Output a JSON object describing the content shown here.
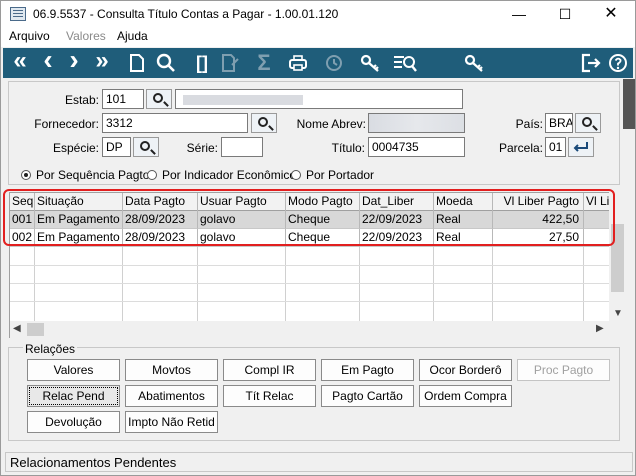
{
  "window": {
    "title": "06.9.5537 - Consulta Título Contas a Pagar - 1.00.01.120",
    "controls": {
      "minimize": "—",
      "maximize": "☐",
      "close": "✕"
    }
  },
  "menu": {
    "items": [
      "Arquivo",
      "Valores",
      "Ajuda"
    ]
  },
  "toolbar": {
    "first_glyph": "«",
    "prev_glyph": "‹",
    "next_glyph": "›",
    "last_glyph": "»",
    "brackets_glyph": "[]",
    "sigma_glyph": "Σ"
  },
  "filters": {
    "estab_label": "Estab:",
    "estab_value": "101",
    "fornecedor_label": "Fornecedor:",
    "fornecedor_value": "3312",
    "especie_label": "Espécie:",
    "especie_value": "DP",
    "serie_label": "Série:",
    "serie_value": "",
    "nome_abrev_label": "Nome Abrev:",
    "titulo_label": "Título:",
    "titulo_value": "0004735",
    "pais_label": "País:",
    "pais_value": "BRA",
    "parcela_label": "Parcela:",
    "parcela_value": "01"
  },
  "sort_options": {
    "opt1": "Por Sequência Pagto",
    "opt2": "Por Indicador Econômico",
    "opt3": "Por Portador",
    "selected": "Por Sequência Pagto"
  },
  "table": {
    "headers": [
      "Seq",
      "Situação",
      "Data Pagto",
      "Usuar Pagto",
      "Modo Pagto",
      "Dat_Liber",
      "Moeda",
      "Vl Liber Pagto",
      "Vl Li"
    ],
    "rows": [
      [
        "001",
        "Em Pagamento",
        "28/09/2023",
        "golavo",
        "Cheque",
        "22/09/2023",
        "Real",
        "422,50",
        ""
      ],
      [
        "002",
        "Em Pagamento",
        "28/09/2023",
        "golavo",
        "Cheque",
        "22/09/2023",
        "Real",
        "27,50",
        ""
      ]
    ]
  },
  "relations": {
    "title": "Relações",
    "row1": [
      "Valores",
      "Movtos",
      "Compl IR",
      "Em Pagto",
      "Ocor Borderô",
      "Proc Pagto"
    ],
    "row2": [
      "Relac Pend",
      "Abatimentos",
      "Tít Relac",
      "Pagto Cartão",
      "Ordem Compra"
    ],
    "row3": [
      "Devolução",
      "Impto Não Retid"
    ]
  },
  "status": {
    "text": "Relacionamentos Pendentes"
  },
  "colors": {
    "toolbar_bg": "#1f5d7a",
    "highlight_outline": "#e21f1f"
  }
}
